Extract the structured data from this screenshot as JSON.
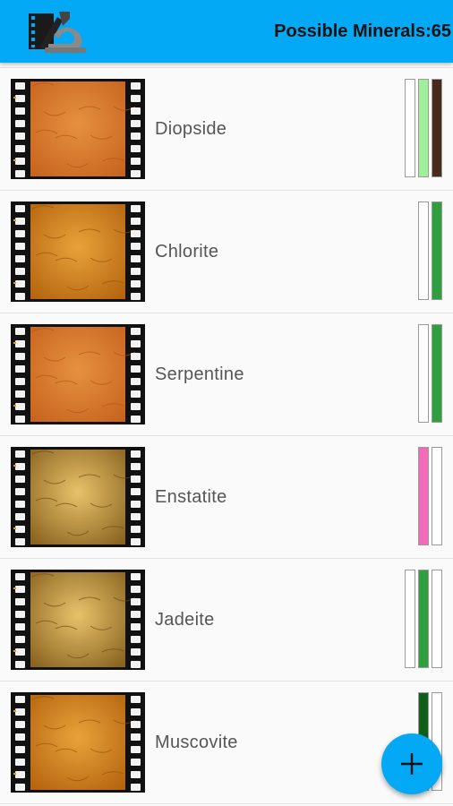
{
  "header": {
    "title": "Possible Minerals:65",
    "logo_icon": "film-microscope-logo-icon"
  },
  "minerals": [
    {
      "name": "",
      "texture": "orange",
      "bars": [
        "#ffffff",
        "#e8d43a",
        "#2e9e3e"
      ]
    },
    {
      "name": "Diopside",
      "texture": "orange",
      "bars": [
        "#ffffff",
        "#9ef09a",
        "#4a2a1c"
      ]
    },
    {
      "name": "Chlorite",
      "texture": "amber",
      "bars": [
        "#ffffff",
        "#2e9e3e"
      ]
    },
    {
      "name": "Serpentine",
      "texture": "orange",
      "bars": [
        "#ffffff",
        "#2e9e3e"
      ]
    },
    {
      "name": "Enstatite",
      "texture": "gold",
      "bars": [
        "#f26bb8",
        "#ffffff"
      ]
    },
    {
      "name": "Jadeite",
      "texture": "gold",
      "bars": [
        "#ffffff",
        "#2e9e3e",
        "#ffffff"
      ]
    },
    {
      "name": "Muscovite",
      "texture": "amber",
      "bars": [
        "#0f5e1a",
        "#ffffff"
      ]
    }
  ],
  "fab": {
    "icon": "plus-icon"
  },
  "colors": {
    "accent": "#03a9f4"
  }
}
